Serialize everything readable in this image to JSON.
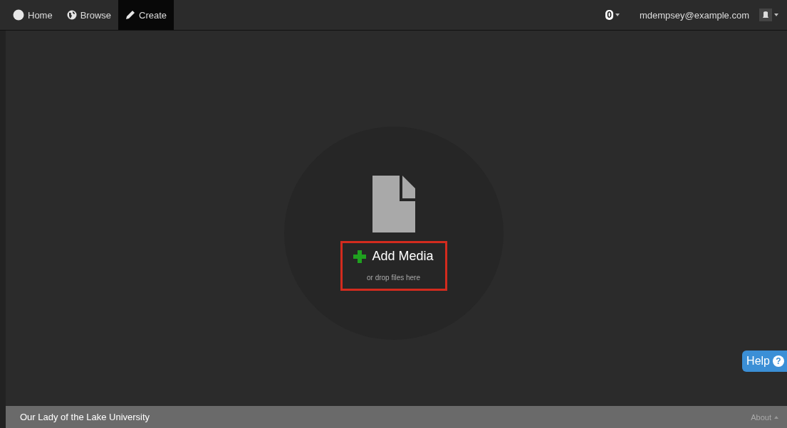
{
  "nav": {
    "items": [
      {
        "label": "Home",
        "selected": false
      },
      {
        "label": "Browse",
        "selected": false
      },
      {
        "label": "Create",
        "selected": true
      }
    ],
    "notifications": {
      "count": "0"
    },
    "user": {
      "email": "mdempsey@example.com"
    }
  },
  "upload": {
    "button": "Add Media",
    "hint": "or drop files here"
  },
  "help": {
    "label": "Help",
    "icon_text": "?"
  },
  "footer": {
    "title": "Our Lady of the Lake University",
    "about": "About"
  }
}
